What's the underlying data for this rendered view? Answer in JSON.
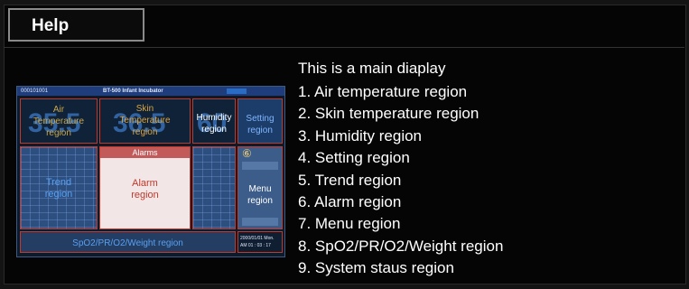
{
  "help_tab": {
    "label": "Help"
  },
  "description": {
    "title": "This is a main diaplay",
    "items": [
      "1. Air temperature region",
      "2. Skin temperature region",
      "3. Humidity region",
      "4. Setting region",
      "5. Trend region",
      "6. Alarm region",
      "7. Menu region",
      "8. SpO2/PR/O2/Weight region",
      "9. System staus region"
    ]
  },
  "thumbnail": {
    "device_id": "000101001",
    "model": "BT-500 Infant Incubator",
    "air_label": "Air\nTemperature\nregion",
    "skin_label": "Skin\nTemperature\nregion",
    "humidity_label": "Humidity\nregion",
    "setting_label": "Setting\nregion",
    "trend_label": "Trend\nregion",
    "alarm_header": "Alarms",
    "alarm_label": "Alarm\nregion",
    "menu_label": "Menu\nregion",
    "menu_marker": "⑥",
    "spo2_label": "SpO2/PR/O2/Weight region",
    "clock": "2000/01/01 Mon.\nAM 01 : 03 : 17",
    "big_air": "35.5",
    "big_skin": "36.5",
    "big_hum": "60",
    "colors": {
      "red": "#c0392b",
      "blue_label": "#4f8fe0",
      "gold": "#d9a441",
      "white": "#ffffff"
    }
  }
}
